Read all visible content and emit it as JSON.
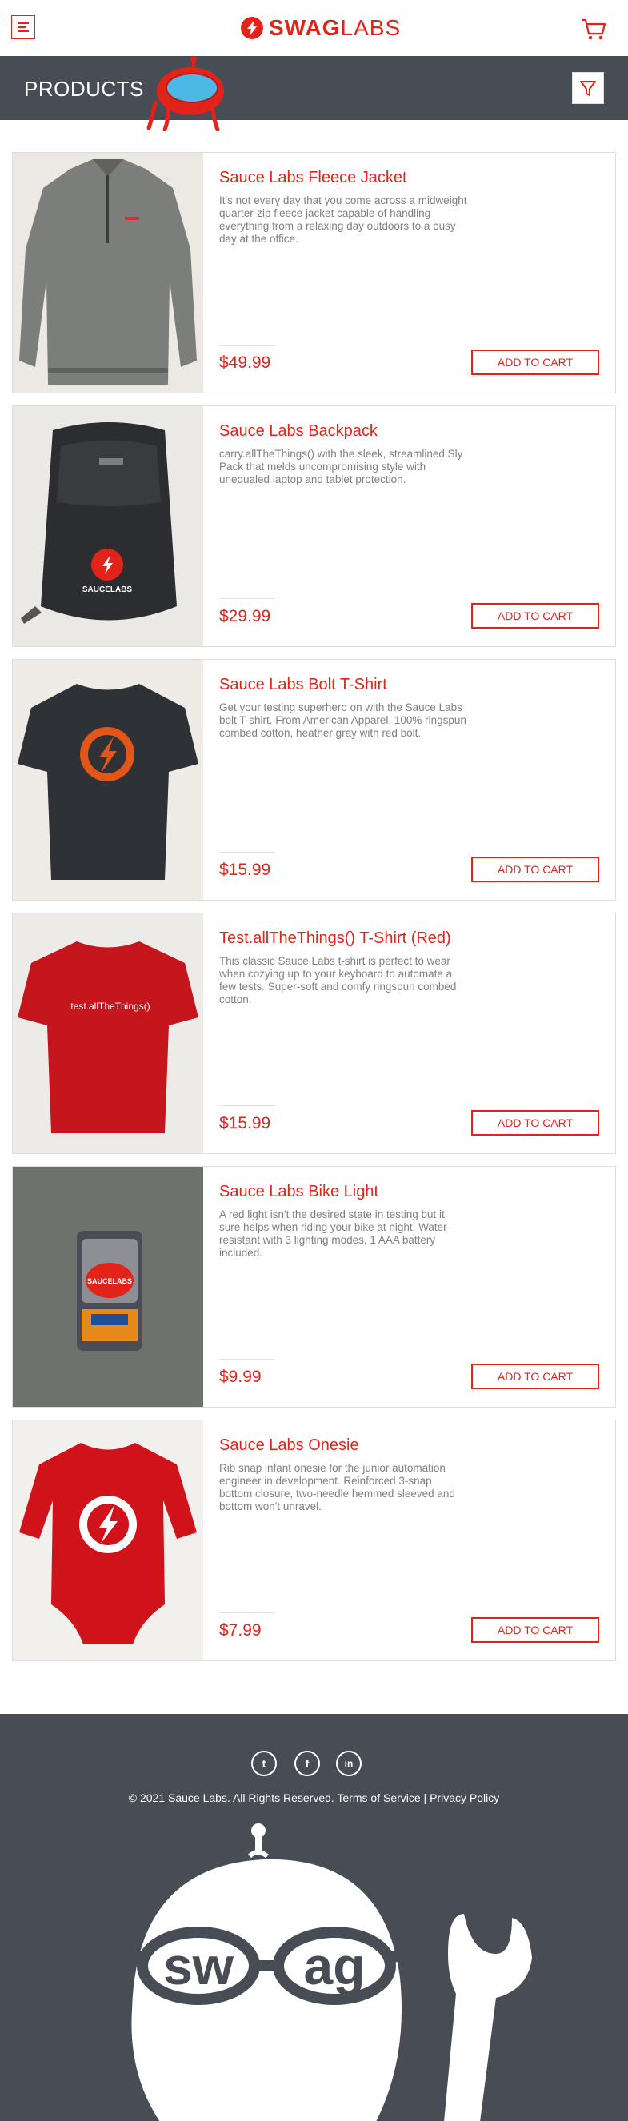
{
  "header": {
    "logo": {
      "bold": "SWAG",
      "thin": "LABS"
    },
    "title": "PRODUCTS"
  },
  "colors": {
    "accent": "#e2231a",
    "dark": "#484c55",
    "muted": "#808080"
  },
  "icons": [
    "menu-icon",
    "cart-icon",
    "filter-icon",
    "twitter-icon",
    "facebook-icon",
    "linkedin-icon"
  ],
  "products": [
    {
      "name": "Sauce Labs Fleece Jacket",
      "desc": "It's not every day that you come across a midweight quarter-zip fleece jacket capable of handling everything from a relaxing day outdoors to a busy day at the office.",
      "price": "$49.99",
      "button": "ADD TO CART"
    },
    {
      "name": "Sauce Labs Backpack",
      "desc": "carry.allTheThings() with the sleek, streamlined Sly Pack that melds uncompromising style with unequaled laptop and tablet protection.",
      "price": "$29.99",
      "button": "ADD TO CART"
    },
    {
      "name": "Sauce Labs Bolt T-Shirt",
      "desc": "Get your testing superhero on with the Sauce Labs bolt T-shirt. From American Apparel, 100% ringspun combed cotton, heather gray with red bolt.",
      "price": "$15.99",
      "button": "ADD TO CART"
    },
    {
      "name": "Test.allTheThings() T-Shirt (Red)",
      "desc": "This classic Sauce Labs t-shirt is perfect to wear when cozying up to your keyboard to automate a few tests. Super-soft and comfy ringspun combed cotton.",
      "price": "$15.99",
      "button": "ADD TO CART"
    },
    {
      "name": "Sauce Labs Bike Light",
      "desc": "A red light isn't the desired state in testing but it sure helps when riding your bike at night. Water-resistant with 3 lighting modes, 1 AAA battery included.",
      "price": "$9.99",
      "button": "ADD TO CART"
    },
    {
      "name": "Sauce Labs Onesie",
      "desc": "Rib snap infant onesie for the junior automation engineer in development. Reinforced 3-snap bottom closure, two-needle hemmed sleeved and bottom won't unravel.",
      "price": "$7.99",
      "button": "ADD TO CART"
    }
  ],
  "image_texts": {
    "backpack": "SAUCELABS",
    "red_shirt": "test.allTheThings()",
    "bike_light": "SAUCELABS"
  },
  "footer": {
    "copyright": "© 2021 Sauce Labs. All Rights Reserved. Terms of Service | Privacy Policy",
    "twitter": "t",
    "facebook": "f",
    "linkedin": "in",
    "mascot_left": "sw",
    "mascot_right": "ag"
  }
}
